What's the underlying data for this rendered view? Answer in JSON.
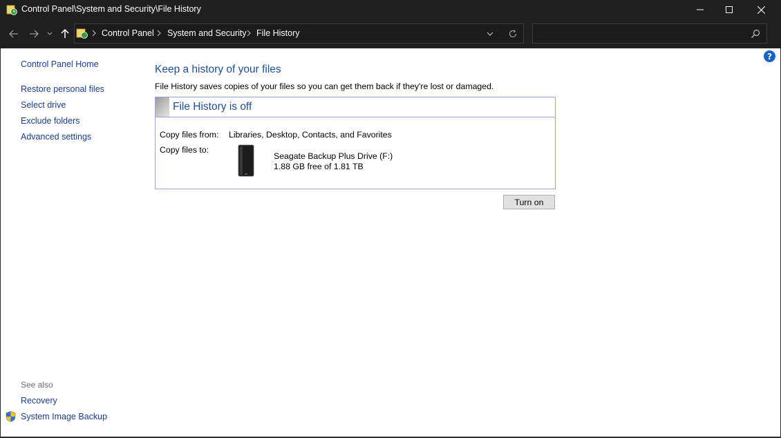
{
  "window": {
    "title": "Control Panel\\System and Security\\File History"
  },
  "nav": {
    "breadcrumbs": [
      "Control Panel",
      "System and Security",
      "File History"
    ],
    "search_placeholder": ""
  },
  "left_pane": {
    "home": "Control Panel Home",
    "links": [
      "Restore personal files",
      "Select drive",
      "Exclude folders",
      "Advanced settings"
    ],
    "see_also_label": "See also",
    "see_also": [
      "Recovery",
      "System Image Backup"
    ]
  },
  "main": {
    "heading": "Keep a history of your files",
    "description": "File History saves copies of your files so you can get them back if they're lost or damaged.",
    "status_title": "File History is off",
    "copy_from_label": "Copy files from:",
    "copy_from_value": "Libraries, Desktop, Contacts, and Favorites",
    "copy_to_label": "Copy files to:",
    "drive_name": "Seagate Backup Plus Drive (F:)",
    "drive_free": "1.88 GB free of 1.81 TB",
    "turn_on_button": "Turn on"
  },
  "colors": {
    "title_bar": "#1f1f1f",
    "link": "#1a3e91",
    "heading": "#1f4e99",
    "box_border": "#9aa4d4"
  },
  "icons": {
    "app": "control-panel-file-history-icon",
    "help": "help-icon",
    "shield": "uac-shield-icon"
  }
}
